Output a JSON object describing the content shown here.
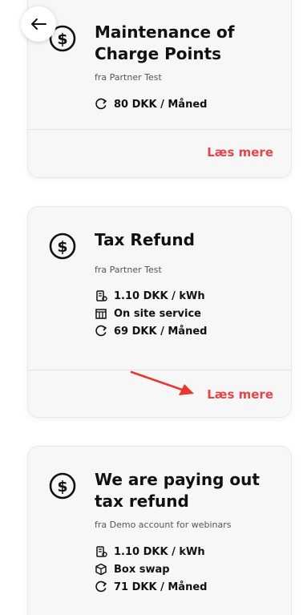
{
  "icons": {
    "back": "arrow-left-icon",
    "service": "coin-dollar-icon",
    "price_kwh": "electricity-meter-icon",
    "on_site": "store-icon",
    "box_swap": "box-icon",
    "monthly": "recurring-fee-icon"
  },
  "colors": {
    "accent": "#e4464b",
    "card_bg": "#f7f7f8",
    "arrow": "#e7372f"
  },
  "cards": [
    {
      "title_line1": "Maintenance of",
      "title_line2": "Charge Points",
      "from": "fra Partner Test",
      "features": [
        "80 DKK / Måned"
      ],
      "read_more": "Læs mere"
    },
    {
      "title_line1": "Tax Refund",
      "from": "fra Partner Test",
      "features": [
        "1.10 DKK / kWh",
        "On site service",
        "69 DKK / Måned"
      ],
      "read_more": "Læs mere"
    },
    {
      "title_line1": "We are paying out",
      "title_line2": "tax refund",
      "from": "fra Demo account for webinars",
      "features": [
        "1.10 DKK / kWh",
        "Box swap",
        "71 DKK / Måned"
      ]
    }
  ]
}
